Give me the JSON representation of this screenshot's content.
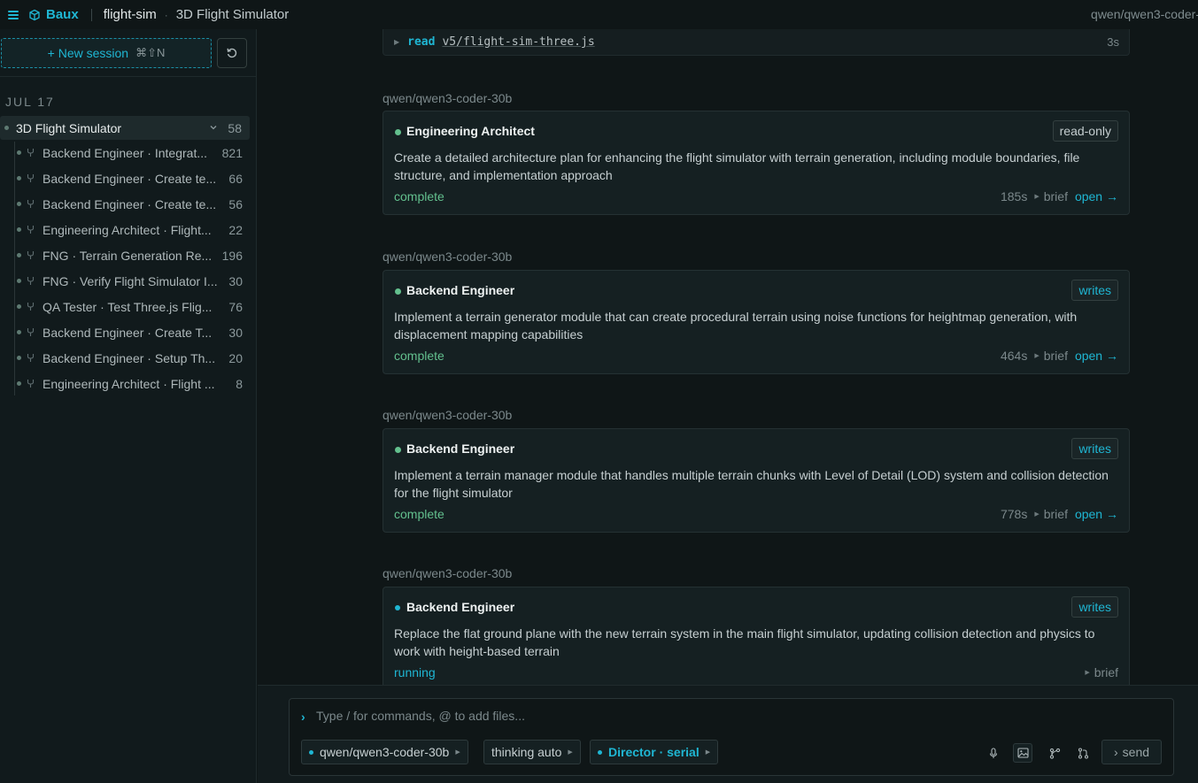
{
  "header": {
    "brand": "Baux",
    "project": "flight-sim",
    "session": "3D Flight Simulator",
    "model": "qwen/qwen3-coder-"
  },
  "sidebar": {
    "new_session_label": "+ New session",
    "new_session_shortcut": "⌘⇧N",
    "date_group": "JUL 17",
    "parent": {
      "title": "3D Flight Simulator",
      "count": "58"
    },
    "children": [
      {
        "title": "Backend Engineer · Integrat...",
        "count": "821"
      },
      {
        "title": "Backend Engineer · Create te...",
        "count": "66"
      },
      {
        "title": "Backend Engineer · Create te...",
        "count": "56"
      },
      {
        "title": "Engineering Architect · Flight...",
        "count": "22"
      },
      {
        "title": "FNG · Terrain Generation Re...",
        "count": "196"
      },
      {
        "title": "FNG · Verify Flight Simulator I...",
        "count": "30"
      },
      {
        "title": "QA Tester · Test Three.js Flig...",
        "count": "76"
      },
      {
        "title": "Backend Engineer · Create T...",
        "count": "30"
      },
      {
        "title": "Backend Engineer · Setup Th...",
        "count": "20"
      },
      {
        "title": "Engineering Architect · Flight ...",
        "count": "8"
      }
    ]
  },
  "main": {
    "read_row": {
      "verb": "read",
      "path": "v5/flight-sim-three.js",
      "time": "3s"
    },
    "tasks": [
      {
        "model": "qwen/qwen3-coder-30b",
        "role": "Engineering Architect",
        "tag": "read-only",
        "desc": "Create a detailed architecture plan for enhancing the flight simulator with terrain generation, including module boundaries, file structure, and implementation approach",
        "state": "complete",
        "duration": "185s",
        "brief": "brief",
        "open": "open →"
      },
      {
        "model": "qwen/qwen3-coder-30b",
        "role": "Backend Engineer",
        "tag": "writes",
        "desc": "Implement a terrain generator module that can create procedural terrain using noise functions for heightmap generation, with displacement mapping capabilities",
        "state": "complete",
        "duration": "464s",
        "brief": "brief",
        "open": "open →"
      },
      {
        "model": "qwen/qwen3-coder-30b",
        "role": "Backend Engineer",
        "tag": "writes",
        "desc": "Implement a terrain manager module that handles multiple terrain chunks with Level of Detail (LOD) system and collision detection for the flight simulator",
        "state": "complete",
        "duration": "778s",
        "brief": "brief",
        "open": "open →"
      },
      {
        "model": "qwen/qwen3-coder-30b",
        "role": "Backend Engineer",
        "tag": "writes",
        "desc": "Replace the flat ground plane with the new terrain system in the main flight simulator, updating collision detection and physics to work with height-based terrain",
        "state": "running",
        "duration": "",
        "brief": "brief",
        "open": ""
      }
    ]
  },
  "composer": {
    "placeholder": "Type / for commands, @ to add files...",
    "model_pill": "qwen/qwen3-coder-30b",
    "thinking_pill": "thinking auto",
    "director_pill": "Director · serial",
    "send_label": "send"
  },
  "colors": {
    "accent": "#1fb6d3",
    "complete": "#63c08e",
    "background": "#0f1617"
  }
}
